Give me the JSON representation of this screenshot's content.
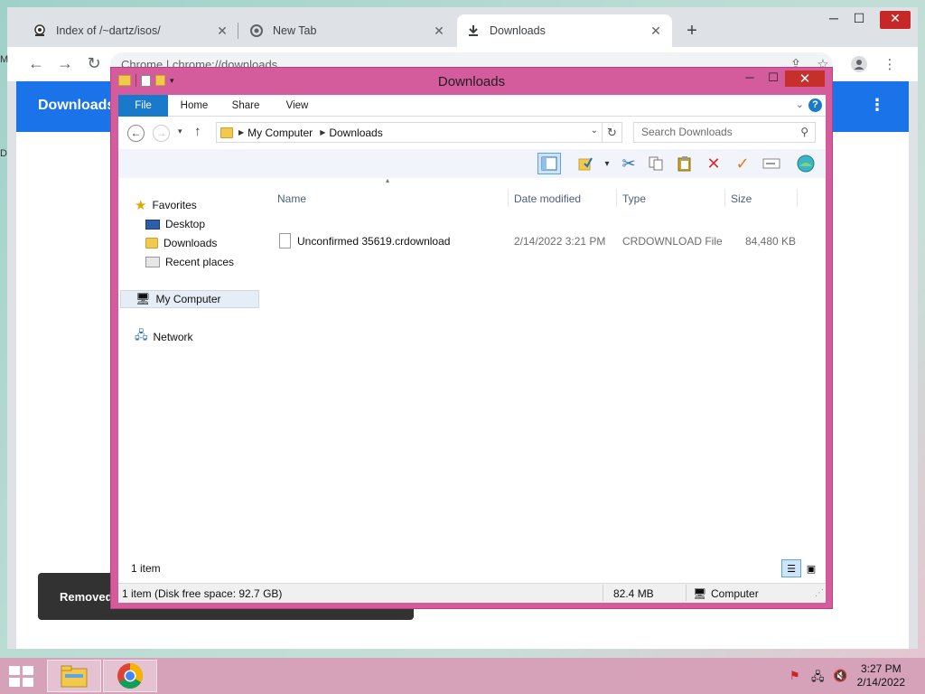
{
  "browser": {
    "tabs": [
      {
        "title": "Index of /~dartz/isos/",
        "close": "✕"
      },
      {
        "title": "New Tab",
        "close": "✕"
      },
      {
        "title": "Downloads",
        "close": "✕"
      }
    ],
    "new_tab": "+",
    "omnibox": "Chrome  |  chrome://downloads",
    "header_title": "Downloads",
    "kebab": "⋮",
    "toast_text": "Removed",
    "edge_glyphs": [
      "M",
      "D"
    ]
  },
  "explorer": {
    "title": "Downloads",
    "ribbon_tabs": [
      "File",
      "Home",
      "Share",
      "View"
    ],
    "help": "?",
    "breadcrumb": [
      "My Computer",
      "Downloads"
    ],
    "search_placeholder": "Search Downloads",
    "nav": {
      "favorites": "Favorites",
      "desktop": "Desktop",
      "downloads": "Downloads",
      "recent": "Recent places",
      "computer": "My Computer",
      "network": "Network"
    },
    "columns": [
      "Name",
      "Date modified",
      "Type",
      "Size"
    ],
    "files": [
      {
        "name": "Unconfirmed 35619.crdownload",
        "date": "2/14/2022 3:21 PM",
        "type": "CRDOWNLOAD File",
        "size": "84,480 KB"
      }
    ],
    "item_count": "1 item",
    "status": {
      "left": "1 item (Disk free space: 92.7 GB)",
      "size": "82.4 MB",
      "location": "Computer"
    }
  },
  "taskbar": {
    "time": "3:27 PM",
    "date": "2/14/2022"
  },
  "colors": {
    "chrome_accent": "#1a73e8",
    "explorer_frame": "#d45b9c",
    "ribbon_file": "#1979ca",
    "taskbar": "#d6a2b9"
  }
}
